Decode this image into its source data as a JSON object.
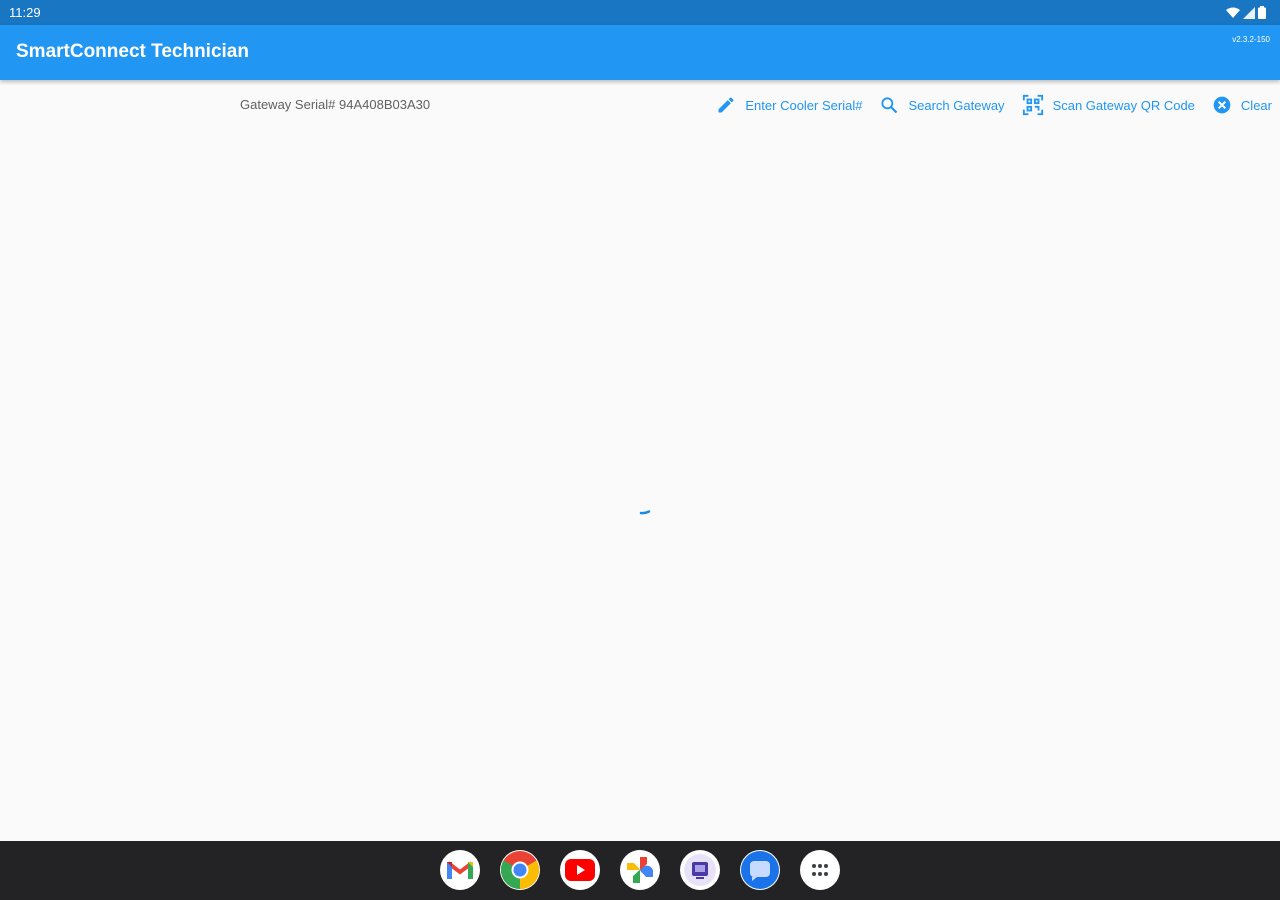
{
  "status_bar": {
    "time": "11:29",
    "icons": [
      "wifi-icon",
      "cell-signal-icon",
      "battery-icon"
    ]
  },
  "app_bar": {
    "title": "SmartConnect Technician",
    "version": "v2.3.2-150",
    "color": "#2196f3"
  },
  "toolbar": {
    "gateway_serial": "Gateway Serial# 94A408B03A30",
    "actions": [
      {
        "label": "Enter Cooler Serial#",
        "icon": "pencil-icon"
      },
      {
        "label": "Search Gateway",
        "icon": "search-icon"
      },
      {
        "label": "Scan Gateway QR Code",
        "icon": "qr-scan-icon"
      },
      {
        "label": "Clear",
        "icon": "clear-circle-icon"
      }
    ],
    "accent": "#2196f3"
  },
  "content": {
    "loading_indicator": "spinner-icon"
  },
  "dock": {
    "apps": [
      "gmail-icon",
      "chrome-icon",
      "youtube-icon",
      "photos-icon",
      "app-icon",
      "messages-icon",
      "app-drawer-icon"
    ]
  }
}
